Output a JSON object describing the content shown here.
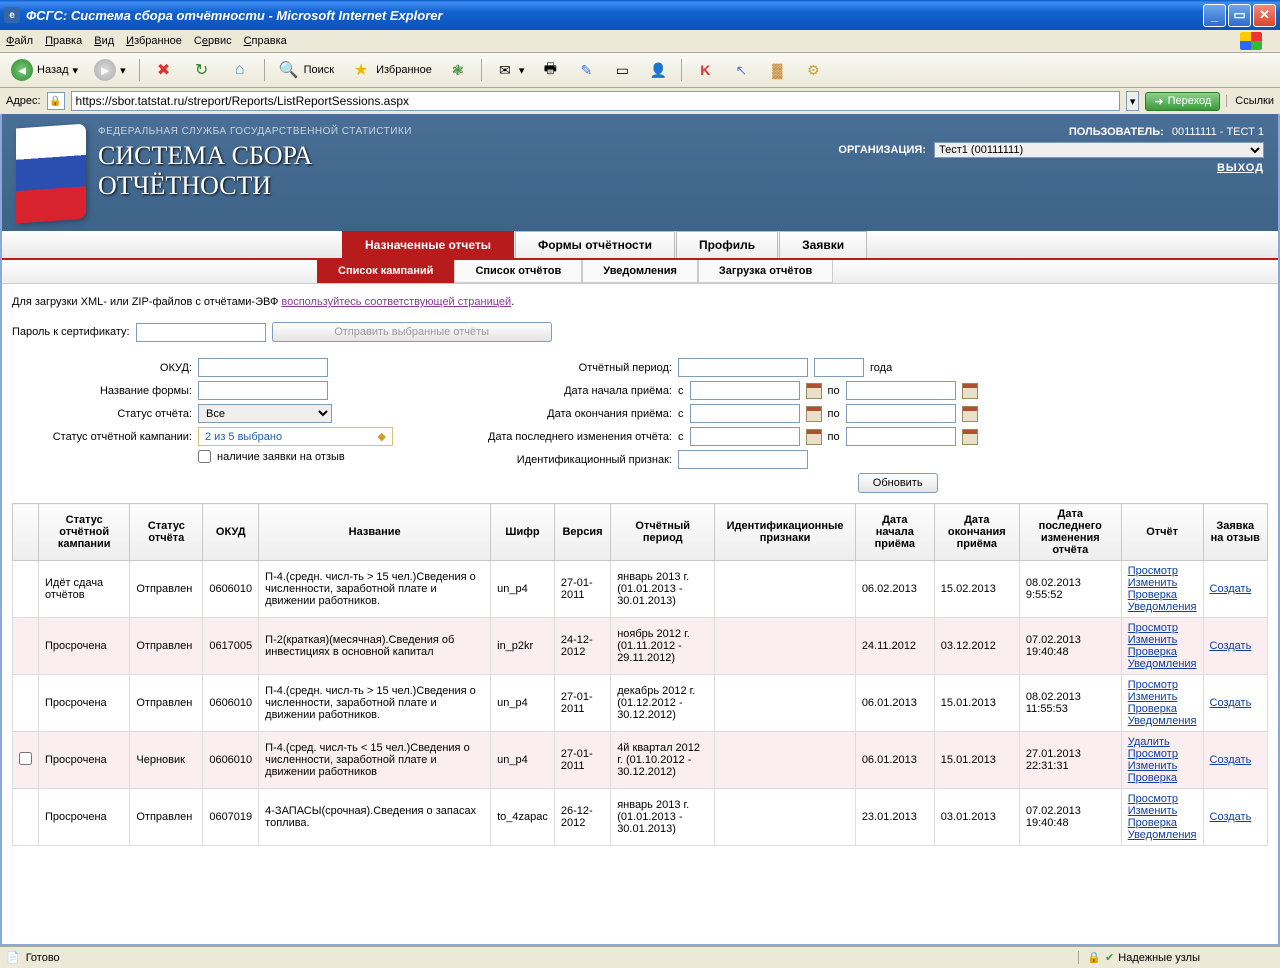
{
  "window": {
    "title": "ФСГС: Система сбора отчётности - Microsoft Internet Explorer"
  },
  "menus": {
    "file": "Файл",
    "edit": "Правка",
    "view": "Вид",
    "favorites": "Избранное",
    "tools": "Сервис",
    "help": "Справка"
  },
  "toolbar": {
    "back": "Назад",
    "search": "Поиск",
    "favorites": "Избранное"
  },
  "address": {
    "label": "Адрес:",
    "url": "https://sbor.tatstat.ru/streport/Reports/ListReportSessions.aspx",
    "go": "Переход",
    "links": "Ссылки"
  },
  "header": {
    "agency": "ФЕДЕРАЛЬНАЯ СЛУЖБА ГОСУДАРСТВЕННОЙ СТАТИСТИКИ",
    "title1": "СИСТЕМА СБОРА",
    "title2": "ОТЧЁТНОСТИ",
    "user_label": "ПОЛЬЗОВАТЕЛЬ:",
    "user_value": "00111111 - ТЕСТ 1",
    "org_label": "ОРГАНИЗАЦИЯ:",
    "org_value": "Тест1 (00111111)",
    "logout": "ВЫХОД"
  },
  "tabs1": [
    "Назначенные отчеты",
    "Формы отчётности",
    "Профиль",
    "Заявки"
  ],
  "tabs2": [
    "Список кампаний",
    "Список отчётов",
    "Уведомления",
    "Загрузка отчётов"
  ],
  "hint": {
    "prefix": "Для загрузки XML- или ZIP-файлов с отчётами-ЭВФ ",
    "link": "воспользуйтесь соответствующей страницей",
    "suffix": "."
  },
  "cert": {
    "label": "Пароль к сертификату:",
    "send_btn": "Отправить выбранные отчёты"
  },
  "filters": {
    "okud": "ОКУД:",
    "form_name": "Название формы:",
    "report_status": "Статус отчёта:",
    "report_status_value": "Все",
    "campaign_status": "Статус отчётной кампании:",
    "campaign_status_value": "2 из 5 выбрано",
    "has_recall": "наличие заявки на отзыв",
    "period": "Отчётный период:",
    "year": "года",
    "date_start": "Дата начала приёма:",
    "date_end": "Дата окончания приёма:",
    "date_change": "Дата последнего изменения отчёта:",
    "ident": "Идентификационный признак:",
    "from": "с",
    "to": "по",
    "refresh": "Обновить"
  },
  "columns": [
    "",
    "Статус отчётной кампании",
    "Статус отчёта",
    "ОКУД",
    "Название",
    "Шифр",
    "Версия",
    "Отчётный период",
    "Идентификационные признаки",
    "Дата начала приёма",
    "Дата окончания приёма",
    "Дата последнего изменения отчёта",
    "Отчёт",
    "Заявка на отзыв"
  ],
  "action_links": {
    "view": "Просмотр",
    "edit": "Изменить",
    "check": "Проверка",
    "notif": "Уведомления",
    "delete": "Удалить",
    "create": "Создать"
  },
  "rows": [
    {
      "camp": "Идёт сдача отчётов",
      "stat": "Отправлен",
      "okud": "0606010",
      "name": "П-4.(средн. числ-ть > 15 чел.)Сведения о численности, заработной плате и движении работников.",
      "code": "un_p4",
      "ver": "27-01-2011",
      "period": "январь 2013 г. (01.01.2013 - 30.01.2013)",
      "ident": "",
      "d1": "06.02.2013",
      "d2": "15.02.2013",
      "d3": "08.02.2013 9:55:52",
      "actions": [
        "view",
        "edit",
        "check",
        "notif"
      ],
      "alt": false
    },
    {
      "camp": "Просрочена",
      "stat": "Отправлен",
      "okud": "0617005",
      "name": "П-2(краткая)(месячная).Сведения об инвестициях в основной капитал",
      "code": "in_p2kr",
      "ver": "24-12-2012",
      "period": "ноябрь 2012 г. (01.11.2012 - 29.11.2012)",
      "ident": "",
      "d1": "24.11.2012",
      "d2": "03.12.2012",
      "d3": "07.02.2013 19:40:48",
      "actions": [
        "view",
        "edit",
        "check",
        "notif"
      ],
      "alt": true
    },
    {
      "camp": "Просрочена",
      "stat": "Отправлен",
      "okud": "0606010",
      "name": "П-4.(средн. числ-ть > 15 чел.)Сведения о численности, заработной плате и движении работников.",
      "code": "un_p4",
      "ver": "27-01-2011",
      "period": "декабрь 2012 г. (01.12.2012 - 30.12.2012)",
      "ident": "",
      "d1": "06.01.2013",
      "d2": "15.01.2013",
      "d3": "08.02.2013 11:55:53",
      "actions": [
        "view",
        "edit",
        "check",
        "notif"
      ],
      "alt": false
    },
    {
      "camp": "Просрочена",
      "stat": "Черновик",
      "okud": "0606010",
      "name": "П-4.(сред. числ-ть < 15 чел.)Сведения о численности, заработной плате и движении работников",
      "code": "un_p4",
      "ver": "27-01-2011",
      "period": "4й квартал 2012 г. (01.10.2012 - 30.12.2012)",
      "ident": "",
      "d1": "06.01.2013",
      "d2": "15.01.2013",
      "d3": "27.01.2013 22:31:31",
      "actions": [
        "delete",
        "view",
        "edit",
        "check"
      ],
      "alt": true,
      "chk": true
    },
    {
      "camp": "Просрочена",
      "stat": "Отправлен",
      "okud": "0607019",
      "name": "4-ЗАПАСЫ(срочная).Сведения о запасах топлива.",
      "code": "to_4zapac",
      "ver": "26-12-2012",
      "period": "январь 2013 г. (01.01.2013 - 30.01.2013)",
      "ident": "",
      "d1": "23.01.2013",
      "d2": "03.01.2013",
      "d3": "07.02.2013 19:40:48",
      "actions": [
        "view",
        "edit",
        "check",
        "notif"
      ],
      "alt": false
    }
  ],
  "status": {
    "ready": "Готово",
    "trusted": "Надежные узлы"
  }
}
